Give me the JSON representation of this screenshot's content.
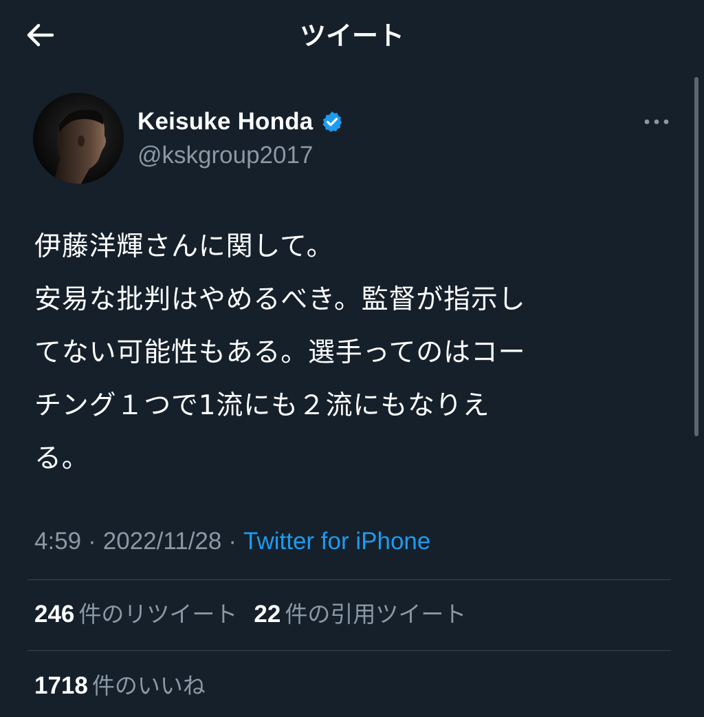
{
  "header": {
    "back_icon": "arrow-left-icon",
    "title": "ツイート"
  },
  "author": {
    "name": "Keisuke Honda",
    "handle": "@kskgroup2017",
    "verified_icon": "verified-badge-icon",
    "verified_color": "#1d9bf0"
  },
  "more_icon": "more-horizontal-icon",
  "tweet": {
    "lines": [
      "伊藤洋輝さんに関して。",
      "安易な批判はやめるべき。監督が指示し",
      "てない可能性もある。選手ってのはコー",
      "チング１つで1流にも２流にもなりえ",
      "る。"
    ],
    "time": "4:59",
    "date": "2022/11/28",
    "source": "Twitter for iPhone",
    "separator": "·"
  },
  "stats": {
    "retweets": {
      "count": "246",
      "label": "件のリツイート"
    },
    "quotes": {
      "count": "22",
      "label": "件の引用ツイート"
    },
    "likes": {
      "count": "1718",
      "label": "件のいいね"
    }
  },
  "colors": {
    "background": "#15202b",
    "text": "#ffffff",
    "muted": "#8b98a5",
    "accent": "#1d9bf0",
    "divider": "#38444d"
  }
}
